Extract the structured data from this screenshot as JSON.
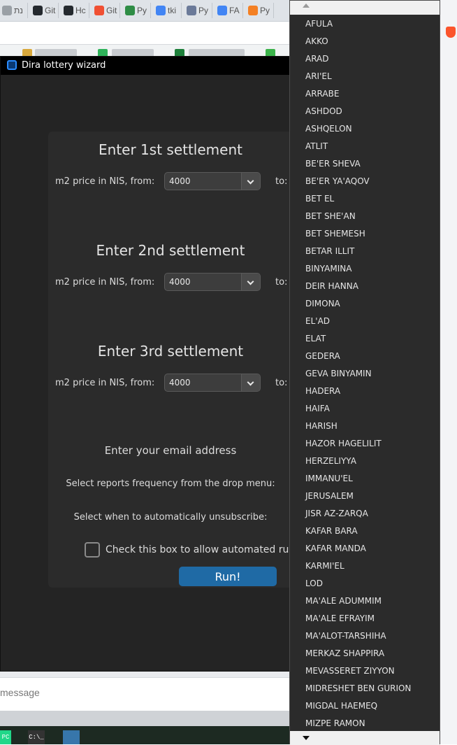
{
  "browser": {
    "tabs": [
      {
        "label": "נת",
        "icon": "tab-icon",
        "color": "#9aa0a6"
      },
      {
        "label": "Git",
        "icon": "github-icon",
        "color": "#24292e"
      },
      {
        "label": "Hc",
        "icon": "github-icon",
        "color": "#24292e"
      },
      {
        "label": "Git",
        "icon": "git-icon",
        "color": "#f05033"
      },
      {
        "label": "Py",
        "icon": "geeksforgeeks-icon",
        "color": "#2f8d46"
      },
      {
        "label": "tki",
        "icon": "google-icon",
        "color": "#4285f4"
      },
      {
        "label": "Py",
        "icon": "code-icon",
        "color": "#6b7a99"
      },
      {
        "label": "FA",
        "icon": "google-icon",
        "color": "#4285f4"
      },
      {
        "label": "Py",
        "icon": "stackoverflow-icon",
        "color": "#f48024"
      }
    ],
    "message_placeholder": "message"
  },
  "dialog": {
    "title": "Dira lottery wizard",
    "close_glyph": "×",
    "sections": [
      {
        "heading": "Enter 1st settlement",
        "price_label": "m2 price in NIS, from:",
        "price_from": "4000",
        "to_label": "to:"
      },
      {
        "heading": "Enter 2nd settlement",
        "price_label": "m2 price in NIS, from:",
        "price_from": "4000",
        "to_label": "to:"
      },
      {
        "heading": "Enter 3rd settlement",
        "price_label": "m2 price in NIS, from:",
        "price_from": "4000",
        "to_label": "to:"
      }
    ],
    "email_label": "Enter your email address",
    "frequency_label": "Select reports frequency from the drop menu:",
    "unsubscribe_label": "Select when to automatically unsubscribe:",
    "checkbox_label": "Check this box to allow automated runs b",
    "run_button": "Run!"
  },
  "dropdown": {
    "items": [
      "AFULA",
      "AKKO",
      "ARAD",
      "ARI'EL",
      "ARRABE",
      "ASHDOD",
      "ASHQELON",
      "ATLIT",
      "BE'ER SHEVA",
      "BE'ER YA'AQOV",
      "BET EL",
      "BET SHE'AN",
      "BET SHEMESH",
      "BETAR ILLIT",
      "BINYAMINA",
      "DEIR HANNA",
      "DIMONA",
      "EL'AD",
      "ELAT",
      "GEDERA",
      "GEVA BINYAMIN",
      "HADERA",
      "HAIFA",
      "HARISH",
      "HAZOR HAGELILIT",
      "HERZELIYYA",
      "IMMANU'EL",
      "JERUSALEM",
      "JISR AZ-ZARQA",
      "KAFAR BARA",
      "KAFAR MANDA",
      "KARMI'EL",
      "LOD",
      "MA'ALE ADUMMIM",
      "MA'ALE EFRAYIM",
      "MA'ALOT-TARSHIHA",
      "MERKAZ SHAPPIRA",
      "MEVASSERET ZIYYON",
      "MIDRESHET BEN GURION",
      "MIGDAL HAEMEQ",
      "MIZPE RAMON"
    ]
  },
  "taskbar": {
    "apps": [
      {
        "label": "PC",
        "icon": "pycharm-icon",
        "color": "#21d789"
      },
      {
        "label": "C:\\_",
        "icon": "terminal-icon",
        "color": "#333333"
      },
      {
        "label": "",
        "icon": "python-icon",
        "color": "#3776ab"
      }
    ]
  }
}
